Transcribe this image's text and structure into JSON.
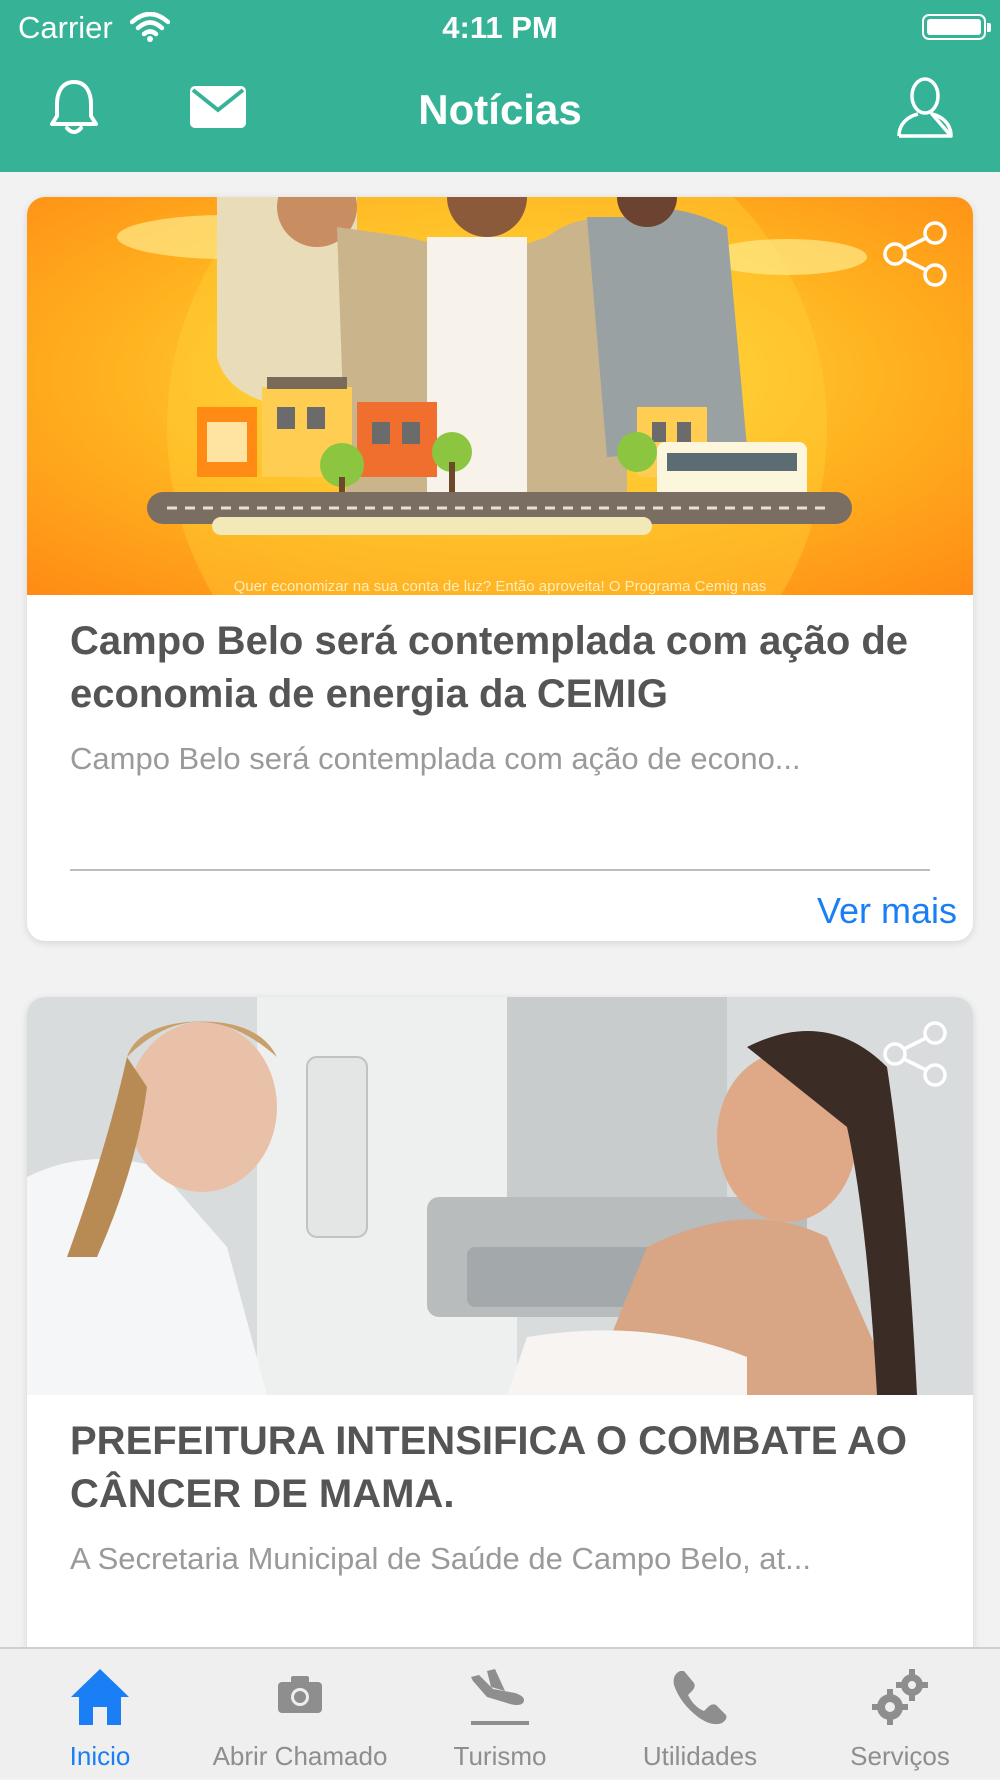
{
  "status_bar": {
    "carrier": "Carrier",
    "time": "4:11 PM"
  },
  "nav": {
    "title": "Notícias"
  },
  "news": [
    {
      "image_caption": "Quer economizar na sua conta de luz? Então aproveita! O Programa Cemig nas",
      "title": "Campo Belo será contemplada com ação de economia de energia da CEMIG",
      "summary": "Campo Belo será contemplada com ação de econo...",
      "more_label": "Ver mais"
    },
    {
      "title": "PREFEITURA INTENSIFICA O COMBATE AO CÂNCER DE MAMA.",
      "summary": "A Secretaria Municipal de Saúde de Campo Belo, at..."
    }
  ],
  "tabbar": {
    "tabs": [
      {
        "label": "Inicio",
        "icon": "home-icon",
        "active": true
      },
      {
        "label": "Abrir Chamado",
        "icon": "camera-icon"
      },
      {
        "label": "Turismo",
        "icon": "plane-icon"
      },
      {
        "label": "Utilidades",
        "icon": "phone-icon"
      },
      {
        "label": "Serviços",
        "icon": "gears-icon"
      }
    ]
  },
  "colors": {
    "header": "#36b396",
    "accent": "#1a7ef4",
    "inactive": "#8e8e8e"
  }
}
